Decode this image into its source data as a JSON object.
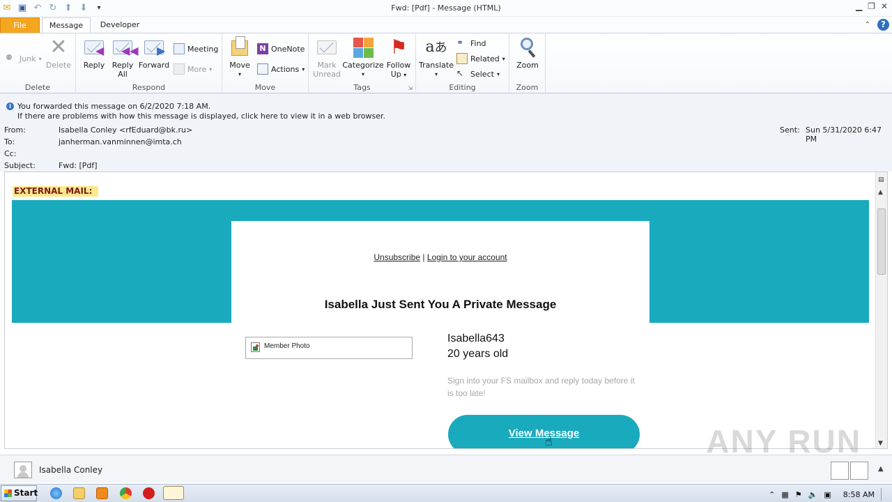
{
  "window": {
    "title": "Fwd: [Pdf]   - Message (HTML)"
  },
  "tabs": {
    "file": "File",
    "message": "Message",
    "developer": "Developer"
  },
  "ribbon": {
    "delete_group": {
      "junk": "Junk",
      "delete": "Delete",
      "label": "Delete"
    },
    "respond_group": {
      "reply": "Reply",
      "reply_all_1": "Reply",
      "reply_all_2": "All",
      "forward": "Forward",
      "meeting": "Meeting",
      "more": "More",
      "label": "Respond"
    },
    "move_group": {
      "move": "Move",
      "onenote": "OneNote",
      "actions": "Actions",
      "label": "Move"
    },
    "tags_group": {
      "mark_unread_1": "Mark",
      "mark_unread_2": "Unread",
      "categorize": "Categorize",
      "follow_up_1": "Follow",
      "follow_up_2": "Up",
      "label": "Tags"
    },
    "editing_group": {
      "translate": "Translate",
      "find": "Find",
      "related": "Related",
      "select": "Select",
      "label": "Editing"
    },
    "zoom_group": {
      "zoom": "Zoom",
      "label": "Zoom"
    }
  },
  "info": {
    "line1": "You forwarded this message on 6/2/2020 7:18 AM.",
    "line2": "If there are problems with how this message is displayed, click here to view it in a web browser."
  },
  "headers": {
    "from_label": "From:",
    "from_value": "Isabella Conley <rfEduard@bk.ru>",
    "to_label": "To:",
    "to_value": "janherman.vanminnen@imta.ch",
    "cc_label": "Cc:",
    "subject_label": "Subject:",
    "subject_value": "Fwd: [Pdf]",
    "sent_label": "Sent:",
    "sent_value": "Sun 5/31/2020 6:47 PM"
  },
  "email": {
    "external_tag": "EXTERNAL MAIL:",
    "unsubscribe": "Unsubscribe",
    "separator": "|",
    "login": "Login to your account",
    "headline": "Isabella Just Sent You A Private Message",
    "photo_alt": "Member Photo",
    "username": "Isabella643",
    "age": "20 years old",
    "hint": "Sign into your FS mailbox and reply today before it is too late!",
    "cta": "View Message"
  },
  "people_pane": {
    "name": "Isabella Conley"
  },
  "watermark": "ANY RUN",
  "taskbar": {
    "start": "Start",
    "clock": "8:58 AM"
  },
  "colors": {
    "teal": "#19aabd",
    "file_tab": "#f4a61f",
    "external_bg": "#fde98b"
  }
}
